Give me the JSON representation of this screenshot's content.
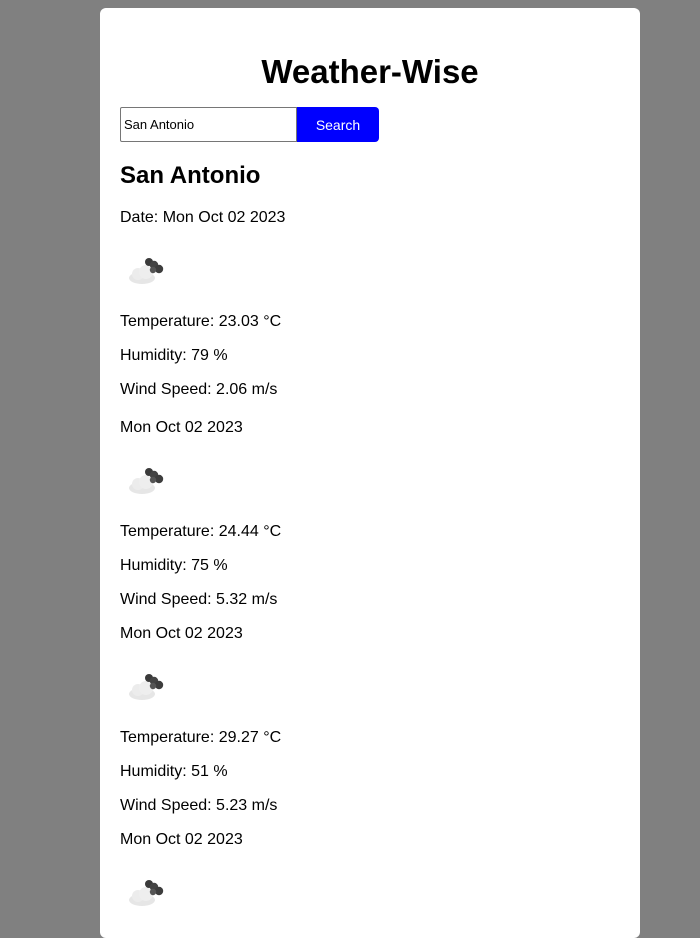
{
  "app": {
    "title": "Weather-Wise"
  },
  "search": {
    "value": "San Antonio",
    "button_label": "Search"
  },
  "current": {
    "city": "San Antonio",
    "date_line": "Date: Mon Oct 02 2023",
    "icon": "cloud-night-icon",
    "temperature": "Temperature: 23.03 °C",
    "humidity": "Humidity: 79 %",
    "wind": "Wind Speed: 2.06 m/s"
  },
  "forecast": [
    {
      "date": "Mon Oct 02 2023",
      "icon": "cloud-night-icon",
      "temperature": "Temperature: 24.44 °C",
      "humidity": "Humidity: 75 %",
      "wind": "Wind Speed: 5.32 m/s"
    },
    {
      "date": "Mon Oct 02 2023",
      "icon": "cloud-night-icon",
      "temperature": "Temperature: 29.27 °C",
      "humidity": "Humidity: 51 %",
      "wind": "Wind Speed: 5.23 m/s"
    },
    {
      "date": "Mon Oct 02 2023",
      "icon": "cloud-night-icon"
    }
  ],
  "colors": {
    "page_background": "#808080",
    "card_background": "#ffffff",
    "button_background": "#0000ff",
    "button_text": "#ffffff"
  }
}
